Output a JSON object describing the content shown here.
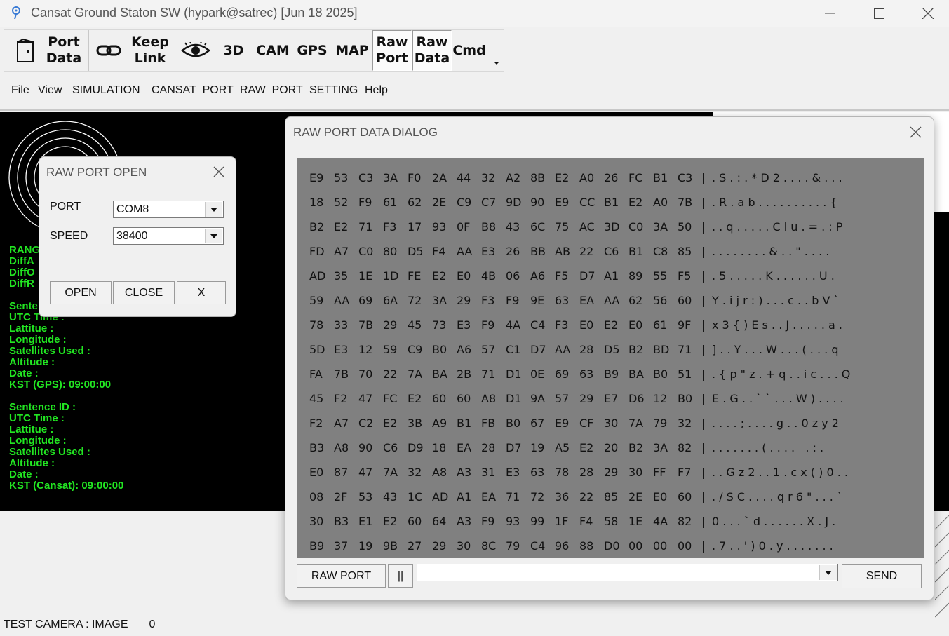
{
  "window": {
    "title": "Cansat Ground Staton SW (hypark@satrec) [Jun 18 2025]"
  },
  "toolbar": {
    "port_data": [
      "Port",
      "Data"
    ],
    "keep_link": [
      "Keep",
      "Link"
    ],
    "3d": "3D",
    "cam": "CAM",
    "gps": "GPS",
    "map": "MAP",
    "raw_port": [
      "Raw",
      "Port"
    ],
    "raw_data": [
      "Raw",
      "Data"
    ],
    "cmd": "Cmd"
  },
  "menu": [
    "File",
    "View",
    "SIMULATION",
    "CANSAT_PORT",
    "RAW_PORT",
    "SETTING",
    "Help"
  ],
  "left_panel": {
    "top_labels": [
      "RANG",
      "DiffA",
      "DiffO",
      "DiffR"
    ],
    "gps_block": [
      "Sente",
      "UTC Time :",
      "Lattitue :",
      "Longitude :",
      "Satellites Used :",
      "Altitude :",
      "Date :",
      "KST (GPS): 09:00:00"
    ],
    "cansat_block": [
      "Sentence ID :",
      "UTC Time :",
      "Lattitue :",
      "Longitude :",
      "Satellites Used :",
      "Altitude :",
      "Date :",
      "KST (Cansat): 09:00:00"
    ]
  },
  "status": {
    "label": "TEST CAMERA : IMAGE",
    "value": "0"
  },
  "raw_port_open": {
    "title": "RAW PORT OPEN",
    "port_label": "PORT",
    "port_value": "COM8",
    "speed_label": "SPEED",
    "speed_value": "38400",
    "open_label": "OPEN",
    "close_label": "CLOSE",
    "x_label": "X"
  },
  "raw_port_dialog": {
    "title": "RAW PORT DATA DIALOG",
    "rows": [
      {
        "hex": [
          "E9",
          "53",
          "C3",
          "3A",
          "F0",
          "2A",
          "44",
          "32",
          "A2",
          "8B",
          "E2",
          "A0",
          "26",
          "FC",
          "B1",
          "C3"
        ],
        "ascii": ". S . : . * D 2 . . . . & . . ."
      },
      {
        "hex": [
          "18",
          "52",
          "F9",
          "61",
          "62",
          "2E",
          "C9",
          "C7",
          "9D",
          "90",
          "E9",
          "CC",
          "B1",
          "E2",
          "A0",
          "7B"
        ],
        "ascii": ". R . a b . . . . . . . . . . {"
      },
      {
        "hex": [
          "B2",
          "E2",
          "71",
          "F3",
          "17",
          "93",
          "0F",
          "B8",
          "43",
          "6C",
          "75",
          "AC",
          "3D",
          "C0",
          "3A",
          "50"
        ],
        "ascii": ". . q . . . . . C l u . = . : P"
      },
      {
        "hex": [
          "FD",
          "A7",
          "C0",
          "80",
          "D5",
          "F4",
          "AA",
          "E3",
          "26",
          "BB",
          "AB",
          "22",
          "C6",
          "B1",
          "C8",
          "85"
        ],
        "ascii": ". . . . . . . . & . . \" . . . ."
      },
      {
        "hex": [
          "AD",
          "35",
          "1E",
          "1D",
          "FE",
          "E2",
          "E0",
          "4B",
          "06",
          "A6",
          "F5",
          "D7",
          "A1",
          "89",
          "55",
          "F5"
        ],
        "ascii": ". 5 . . . . . K . . . . . . U ."
      },
      {
        "hex": [
          "59",
          "AA",
          "69",
          "6A",
          "72",
          "3A",
          "29",
          "F3",
          "F9",
          "9E",
          "63",
          "EA",
          "AA",
          "62",
          "56",
          "60"
        ],
        "ascii": "Y . i j r : ) . . . c . . b V `"
      },
      {
        "hex": [
          "78",
          "33",
          "7B",
          "29",
          "45",
          "73",
          "E3",
          "F9",
          "4A",
          "C4",
          "F3",
          "E0",
          "E2",
          "E0",
          "61",
          "9F"
        ],
        "ascii": "x 3 { ) E s . . J . . . . . a ."
      },
      {
        "hex": [
          "5D",
          "E3",
          "12",
          "59",
          "C9",
          "B0",
          "A6",
          "57",
          "C1",
          "D7",
          "AA",
          "28",
          "D5",
          "B2",
          "BD",
          "71"
        ],
        "ascii": "] . . Y . . . W . . . ( . . . q"
      },
      {
        "hex": [
          "FA",
          "7B",
          "70",
          "22",
          "7A",
          "BA",
          "2B",
          "71",
          "D1",
          "0E",
          "69",
          "63",
          "B9",
          "BA",
          "B0",
          "51"
        ],
        "ascii": ". { p \" z . + q . . i c . . . Q"
      },
      {
        "hex": [
          "45",
          "F2",
          "47",
          "FC",
          "E2",
          "60",
          "60",
          "A8",
          "D1",
          "9A",
          "57",
          "29",
          "E7",
          "D6",
          "12",
          "B0"
        ],
        "ascii": "E . G . . ` ` . . . W ) . . . ."
      },
      {
        "hex": [
          "F2",
          "A7",
          "C2",
          "E2",
          "3B",
          "A9",
          "B1",
          "FB",
          "B0",
          "67",
          "E9",
          "CF",
          "30",
          "7A",
          "79",
          "32"
        ],
        "ascii": ". . . . ; . . . . g . . 0 z y 2"
      },
      {
        "hex": [
          "B3",
          "A8",
          "90",
          "C6",
          "D9",
          "18",
          "EA",
          "28",
          "D7",
          "19",
          "A5",
          "E2",
          "20",
          "B2",
          "3A",
          "82"
        ],
        "ascii": ". . . . . . . ( . . . .   . : ."
      },
      {
        "hex": [
          "E0",
          "87",
          "47",
          "7A",
          "32",
          "A8",
          "A3",
          "31",
          "E3",
          "63",
          "78",
          "28",
          "29",
          "30",
          "FF",
          "F7"
        ],
        "ascii": ". . G z 2 . . 1 . c x ( ) 0 . ."
      },
      {
        "hex": [
          "08",
          "2F",
          "53",
          "43",
          "1C",
          "AD",
          "A1",
          "EA",
          "71",
          "72",
          "36",
          "22",
          "85",
          "2E",
          "E0",
          "60"
        ],
        "ascii": ". / S C . . . . q r 6 \" . . . `"
      },
      {
        "hex": [
          "30",
          "B3",
          "E1",
          "E2",
          "60",
          "64",
          "A3",
          "F9",
          "93",
          "99",
          "1F",
          "F4",
          "58",
          "1E",
          "4A",
          "82"
        ],
        "ascii": "0 . . . ` d . . . . . . X . J ."
      },
      {
        "hex": [
          "B9",
          "37",
          "19",
          "9B",
          "27",
          "29",
          "30",
          "8C",
          "79",
          "C4",
          "96",
          "88",
          "D0",
          "00",
          "00",
          "00"
        ],
        "ascii": ". 7 . . ' ) 0 . y . . . . . . ."
      }
    ],
    "raw_port_button": "RAW PORT",
    "pause_button": "||",
    "command_value": "",
    "send_button": "SEND"
  },
  "colors": {
    "panel_bg": "#000000",
    "panel_text": "#22e622",
    "hex_bg": "#808080"
  }
}
